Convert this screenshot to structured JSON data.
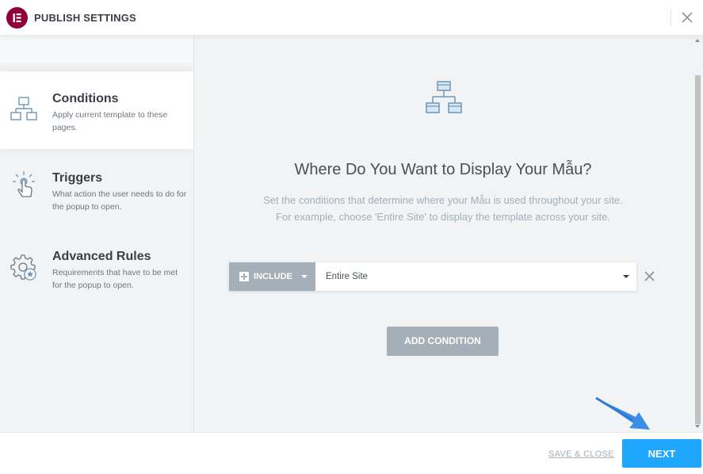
{
  "header": {
    "title": "PUBLISH SETTINGS",
    "logo_icon": "elementor-logo",
    "close_icon": "close-icon"
  },
  "sidebar": {
    "items": [
      {
        "name": "Conditions",
        "description": "Apply current template to these pages.",
        "icon": "sitemap-icon",
        "active": true
      },
      {
        "name": "Triggers",
        "description": "What action the user needs to do for the popup to open.",
        "icon": "touch-icon",
        "active": false
      },
      {
        "name": "Advanced Rules",
        "description": "Requirements that have to be met for the popup to open.",
        "icon": "gear-star-icon",
        "active": false
      }
    ]
  },
  "main": {
    "icon": "sitemap-icon",
    "heading": "Where Do You Want to Display Your Mẫu?",
    "description_line1": "Set the conditions that determine where your Mẫu is used throughout your site.",
    "description_line2": "For example, choose 'Entire Site' to display the template across your site.",
    "condition": {
      "type_label": "INCLUDE",
      "value": "Entire Site"
    },
    "add_condition_label": "ADD CONDITION"
  },
  "footer": {
    "save_close_label": "SAVE & CLOSE",
    "next_label": "NEXT"
  },
  "colors": {
    "brand": "#92003b",
    "accent": "#1ea7fd",
    "muted": "#a4afb7",
    "background": "#f1f3f5"
  }
}
